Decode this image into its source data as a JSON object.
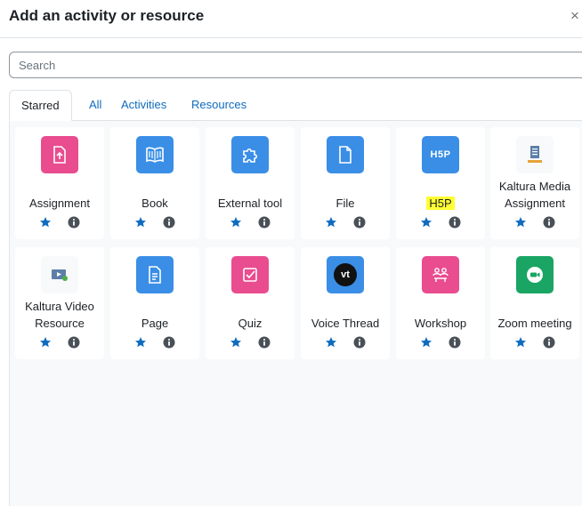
{
  "modal": {
    "title": "Add an activity or resource",
    "close": "×"
  },
  "search": {
    "placeholder": "Search"
  },
  "tabs": [
    {
      "label": "Starred"
    },
    {
      "label": "All"
    },
    {
      "label": "Activities"
    },
    {
      "label": "Resources"
    }
  ],
  "cards": [
    {
      "name": "Assignment"
    },
    {
      "name": "Book"
    },
    {
      "name": "External tool"
    },
    {
      "name": "File"
    },
    {
      "name": "H5P"
    },
    {
      "name_line1": "Kaltura Media",
      "name_line2": "Assignment"
    },
    {
      "name_line1": "Kaltura Video",
      "name_line2": "Resource"
    },
    {
      "name": "Page"
    },
    {
      "name": "Quiz"
    },
    {
      "name": "Voice Thread"
    },
    {
      "name": "Workshop"
    },
    {
      "name": "Zoom meeting"
    }
  ],
  "icons": {
    "h5p_text": "H5P",
    "voicethread_text": "vt"
  },
  "colors": {
    "pink": "#e94c8f",
    "blue": "#3a8ee6",
    "green": "#1aa564",
    "star": "#0f6cbf",
    "info": "#495057",
    "highlight": "#ffff33"
  }
}
